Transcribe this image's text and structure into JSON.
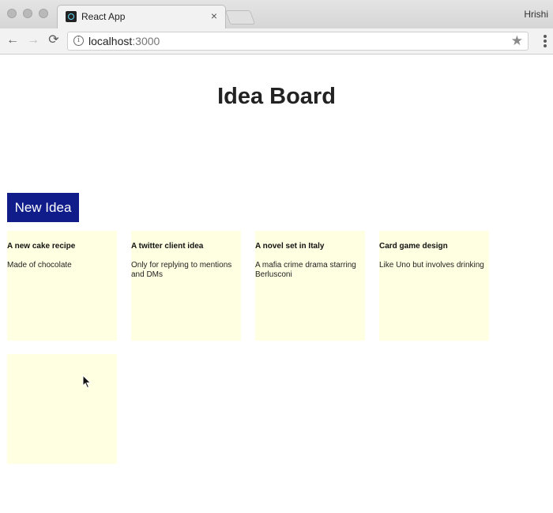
{
  "browser": {
    "tab_title": "React App",
    "tab_close": "×",
    "profile_name": "Hrishi",
    "url_host": "localhost",
    "url_port": ":3000",
    "back_icon": "←",
    "forward_icon": "→",
    "reload_icon": "⟳",
    "info_icon": "i",
    "star_icon": "★"
  },
  "page": {
    "title": "Idea Board",
    "new_idea_label": "New Idea",
    "accent_color": "#0f1c8a",
    "tile_color": "#ffffe2"
  },
  "ideas": [
    {
      "title": "A new cake recipe",
      "body": "Made of chocolate"
    },
    {
      "title": "A twitter client idea",
      "body": "Only for replying to mentions and DMs"
    },
    {
      "title": "A novel set in Italy",
      "body": "A mafia crime drama starring Berlusconi"
    },
    {
      "title": "Card game design",
      "body": "Like Uno but involves drinking"
    },
    {
      "title": "",
      "body": ""
    }
  ]
}
